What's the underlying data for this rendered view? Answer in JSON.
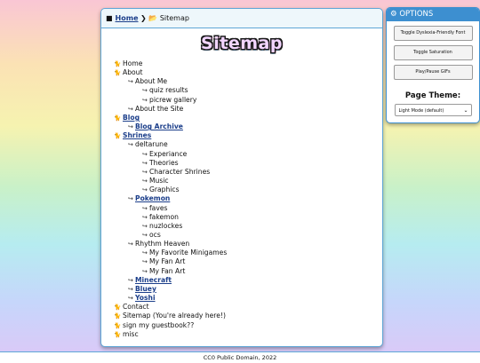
{
  "breadcrumb": {
    "home_icon": "▌",
    "home": "Home",
    "sep": ">",
    "folder_icon": "📂",
    "current": "Sitemap"
  },
  "page_title": "Sitemap",
  "tree": {
    "home": "Home",
    "about": "About",
    "about_me": "About Me",
    "quiz_results": "quiz results",
    "picrew_gallery": "picrew gallery",
    "about_site": "About the Site",
    "blog": "Blog",
    "blog_archive": "Blog Archive",
    "shrines": "Shrines",
    "deltarune": "deltarune",
    "experiance": "Experiance",
    "theories": "Theories",
    "character_shrines": "Character Shrines",
    "music": "Music",
    "graphics": "Graphics",
    "pokemon": "Pokemon",
    "faves": "faves",
    "fakemon": "fakemon",
    "nuzlockes": "nuzlockes",
    "ocs": "ocs",
    "rhythm_heaven": "Rhythm Heaven",
    "fav_minigames": "My Favorite Minigames",
    "fan_art_1": "My Fan Art",
    "fan_art_2": "My Fan Art",
    "minecraft": "Minecraft",
    "bluey": "Bluey",
    "yoshi": "Yoshi",
    "contact": "Contact",
    "sitemap": "Sitemap (You're already here!)",
    "guestbook": "sign my guestbook??",
    "misc": "misc"
  },
  "options": {
    "header": "OPTIONS",
    "dyslexia_btn": "Toggle Dyslexia-Friendly Font",
    "saturation_btn": "Toggle Saturation",
    "gifs_btn": "Play/Pause GIFs",
    "theme_label": "Page Theme:",
    "theme_selected": "Light Mode (default)"
  },
  "footer": "CC0 Public Domain, 2022"
}
